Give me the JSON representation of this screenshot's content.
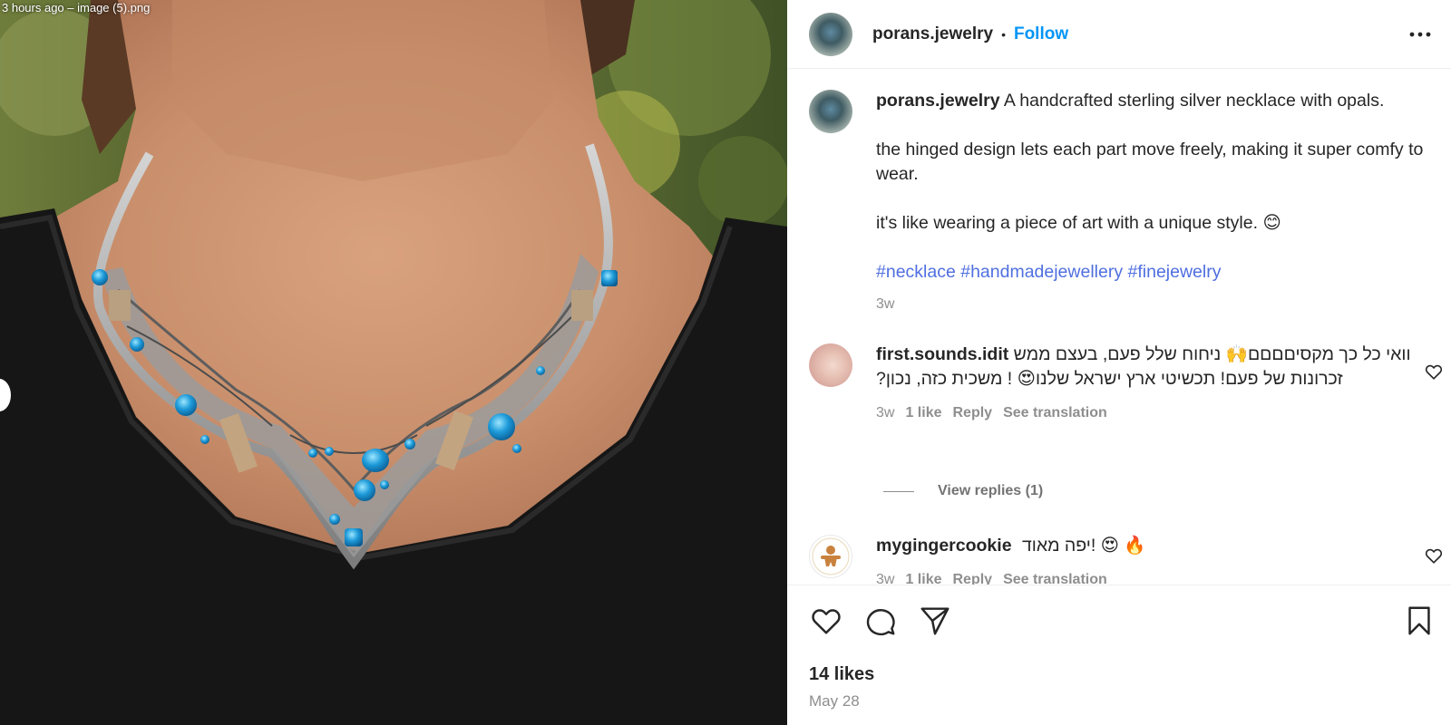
{
  "image_panel": {
    "filename_overlay": "3 hours ago – image (5).png"
  },
  "header": {
    "username": "porans.jewelry",
    "separator": "•",
    "follow_label": "Follow",
    "more_icon": "more-horizontal-icon"
  },
  "caption": {
    "username": "porans.jewelry",
    "line1": "A handcrafted sterling silver necklace with opals.",
    "line2": "the hinged design lets each part move freely, making it super comfy to wear.",
    "line3": "it's like wearing a piece of art with a unique style. 😊",
    "hashtags": "#necklace #handmadejewellery #finejewelry",
    "time": "3w"
  },
  "comments": [
    {
      "username": "first.sounds.idit",
      "text": "וואי כל כך מקסיםםםם🙌 ניחוח שלל פעם, בעצם ממש זכרונות של פעם! תכשיטי ארץ ישראל שלנו😍 ! משכית כזה, נכון?",
      "time": "3w",
      "likes": "1 like",
      "reply": "Reply",
      "translate": "See translation",
      "view_replies": "View replies (1)"
    },
    {
      "username": "mygingercookie",
      "text": "🔥 😍 !יפה מאוד",
      "time": "3w",
      "likes": "1 like",
      "reply": "Reply",
      "translate": "See translation"
    }
  ],
  "actions": {
    "icons": [
      "heart-icon",
      "comment-icon",
      "share-icon",
      "bookmark-icon"
    ],
    "likes": "14 likes",
    "date": "May 28"
  },
  "colors": {
    "accent": "#0095f6",
    "hashtag": "#4f6fe0",
    "muted": "#8e8e8e",
    "text": "#262626"
  }
}
